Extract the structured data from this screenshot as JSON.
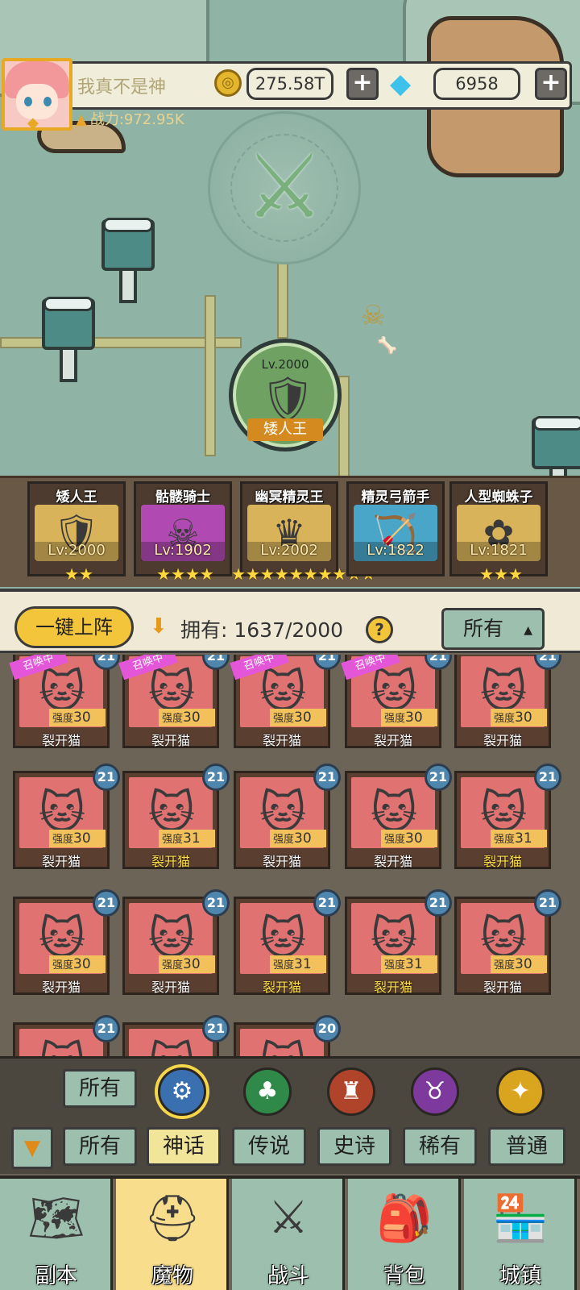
{
  "player": {
    "name": "我真不是神",
    "gold": "275.58T",
    "gems": "6958",
    "power": "战力:972.95K"
  },
  "boss_node": {
    "level": "Lv.2000",
    "name": "矮人王"
  },
  "team": [
    {
      "name": "矮人王",
      "level": "Lv:2000",
      "stars": "★★",
      "color": "#d9b35a",
      "icon": "dwarf-king-icon"
    },
    {
      "name": "骷髅骑士",
      "level": "Lv:1902",
      "stars": "★★★★",
      "color": "#b04ab2",
      "icon": "skeleton-knight-icon"
    },
    {
      "name": "幽冥精灵王",
      "level": "Lv:2002",
      "stars": "★★★★★★★★★★",
      "color": "#d9b35a",
      "icon": "nether-elf-king-icon"
    },
    {
      "name": "精灵弓箭手",
      "level": "Lv:1822",
      "stars": "",
      "color": "#4aa6c8",
      "icon": "elf-archer-icon"
    },
    {
      "name": "人型蜘蛛子",
      "level": "Lv:1821",
      "stars": "★★★",
      "color": "#d9b35a",
      "icon": "spider-girl-icon"
    }
  ],
  "owned": {
    "deploy_label": "一键上阵",
    "owned_label": "拥有: 1637/2000",
    "help": "?",
    "filter_value": "所有"
  },
  "monsters": [
    {
      "name": "裂开猫",
      "power_label": "强度",
      "power": "30",
      "level": "21",
      "summon": "召唤中",
      "gold": false,
      "color": "#e07272"
    },
    {
      "name": "裂开猫",
      "power_label": "强度",
      "power": "30",
      "level": "21",
      "summon": "召唤中",
      "gold": false,
      "color": "#e07272"
    },
    {
      "name": "裂开猫",
      "power_label": "强度",
      "power": "30",
      "level": "21",
      "summon": "召唤中",
      "gold": false,
      "color": "#e07272"
    },
    {
      "name": "裂开猫",
      "power_label": "强度",
      "power": "30",
      "level": "21",
      "summon": "召唤中",
      "gold": false,
      "color": "#e07272"
    },
    {
      "name": "裂开猫",
      "power_label": "强度",
      "power": "30",
      "level": "21",
      "summon": "",
      "gold": false,
      "color": "#e07272"
    },
    {
      "name": "裂开猫",
      "power_label": "强度",
      "power": "30",
      "level": "21",
      "summon": "",
      "gold": false,
      "color": "#e07272"
    },
    {
      "name": "裂开猫",
      "power_label": "强度",
      "power": "31",
      "level": "21",
      "summon": "",
      "gold": true,
      "color": "#e07272"
    },
    {
      "name": "裂开猫",
      "power_label": "强度",
      "power": "30",
      "level": "21",
      "summon": "",
      "gold": false,
      "color": "#e07272"
    },
    {
      "name": "裂开猫",
      "power_label": "强度",
      "power": "30",
      "level": "21",
      "summon": "",
      "gold": false,
      "color": "#e07272"
    },
    {
      "name": "裂开猫",
      "power_label": "强度",
      "power": "31",
      "level": "21",
      "summon": "",
      "gold": true,
      "color": "#e07272"
    },
    {
      "name": "裂开猫",
      "power_label": "强度",
      "power": "30",
      "level": "21",
      "summon": "",
      "gold": false,
      "color": "#e07272"
    },
    {
      "name": "裂开猫",
      "power_label": "强度",
      "power": "30",
      "level": "21",
      "summon": "",
      "gold": false,
      "color": "#e07272"
    },
    {
      "name": "裂开猫",
      "power_label": "强度",
      "power": "31",
      "level": "21",
      "summon": "",
      "gold": true,
      "color": "#e07272"
    },
    {
      "name": "裂开猫",
      "power_label": "强度",
      "power": "31",
      "level": "21",
      "summon": "",
      "gold": true,
      "color": "#e07272"
    },
    {
      "name": "裂开猫",
      "power_label": "强度",
      "power": "30",
      "level": "21",
      "summon": "",
      "gold": false,
      "color": "#e07272"
    },
    {
      "name": "",
      "power_label": "",
      "power": "",
      "level": "21",
      "summon": "",
      "gold": false,
      "color": "#e07272"
    },
    {
      "name": "",
      "power_label": "",
      "power": "",
      "level": "21",
      "summon": "",
      "gold": false,
      "color": "#e07272"
    },
    {
      "name": "",
      "power_label": "",
      "power": "",
      "level": "20",
      "summon": "",
      "gold": false,
      "color": "#e07272"
    }
  ],
  "filter_panel": {
    "faction_all": "所有",
    "factions": [
      {
        "icon": "mech-faction-icon",
        "color": "#3a6fb0"
      },
      {
        "icon": "nature-faction-icon",
        "color": "#2f8a4a"
      },
      {
        "icon": "inferno-faction-icon",
        "color": "#b0442a"
      },
      {
        "icon": "demon-faction-icon",
        "color": "#7d3a9c"
      },
      {
        "icon": "holy-faction-icon",
        "color": "#d9a51f"
      }
    ],
    "rarities": [
      "所有",
      "神话",
      "传说",
      "史诗",
      "稀有",
      "普通"
    ],
    "active_rarity": "神话"
  },
  "nav": [
    {
      "label": "副本",
      "icon": "map-icon",
      "active": false
    },
    {
      "label": "魔物",
      "icon": "monster-helmet-icon",
      "active": true
    },
    {
      "label": "战斗",
      "icon": "crossed-swords-icon",
      "active": false
    },
    {
      "label": "背包",
      "icon": "backpack-icon",
      "active": false
    },
    {
      "label": "城镇",
      "icon": "town-shop-icon",
      "active": false
    }
  ],
  "colors": {
    "accent_gold": "#f3c53a",
    "panel_green": "#9cc0ad",
    "active_tab": "#f7dd8c",
    "card_red": "#e07272",
    "level_badge": "#4f86ad",
    "summon_pink": "#e456d8"
  }
}
